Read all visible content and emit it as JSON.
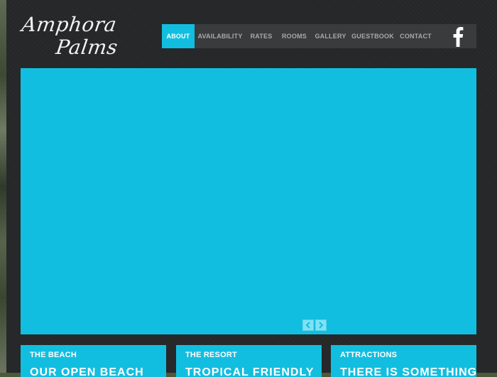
{
  "logo": {
    "line1": "Amphora",
    "line2": "Palms"
  },
  "nav": {
    "items": [
      {
        "label": "ABOUT",
        "active": true
      },
      {
        "label": "AVAILABILITY"
      },
      {
        "label": "RATES"
      },
      {
        "label": "ROOMS"
      },
      {
        "label": "GALLERY"
      },
      {
        "label": "GUESTBOOK"
      },
      {
        "label": "CONTACT"
      }
    ],
    "social_icon": "facebook-icon"
  },
  "slider": {
    "prev_icon": "chevron-left-icon",
    "next_icon": "chevron-right-icon"
  },
  "cards": [
    {
      "title": "THE BEACH",
      "subtitle": "OUR OPEN BEACH"
    },
    {
      "title": "THE RESORT",
      "subtitle": "TROPICAL FRIENDLY"
    },
    {
      "title": "ATTRACTIONS",
      "subtitle": "THERE IS SOMETHING"
    }
  ],
  "colors": {
    "accent": "#12bedf",
    "page_bg": "#262728",
    "nav_bg": "#3a3b3d",
    "nav_text": "#a9a9a9"
  }
}
